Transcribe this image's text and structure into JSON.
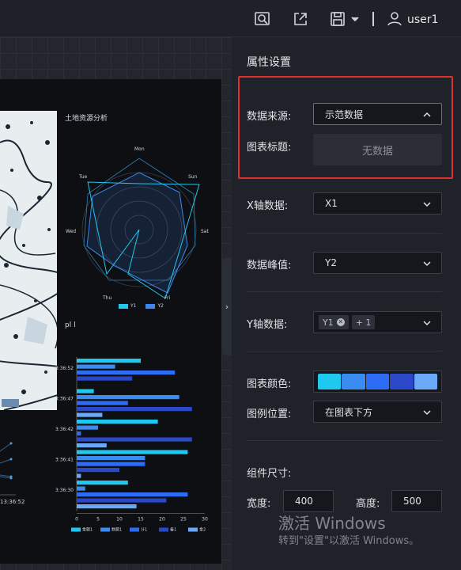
{
  "topbar": {
    "icons": [
      "search-doc-icon",
      "export-icon",
      "save-icon"
    ],
    "user_name": "user1"
  },
  "canvas": {
    "radar": {
      "title": "土地资源分析",
      "axes": [
        "Mon",
        "Sun",
        "Sat",
        "Fri",
        "Thu",
        "Wed",
        "Tue"
      ],
      "legend": [
        "Y1",
        "Y2"
      ]
    },
    "bar": {
      "title": "pl l",
      "categories": [
        "3:36:52",
        "3:36:47",
        "3:36:42",
        "3:36:41",
        "3:36:30"
      ],
      "x_ticks": [
        "0",
        "5",
        "10",
        "15",
        "20",
        "25",
        "30"
      ],
      "legend": [
        "金额1",
        "数额1",
        "计1",
        "备1",
        "金2"
      ]
    },
    "line_time_label": "13:36:52"
  },
  "chart_data": [
    {
      "type": "bar",
      "orientation": "horizontal",
      "title": "pl l",
      "categories": [
        "3:36:52",
        "3:36:47",
        "3:36:42",
        "3:36:41",
        "3:36:30"
      ],
      "xlim": [
        0,
        30
      ],
      "series": [
        {
          "name": "金额1",
          "values": [
            15,
            4,
            19,
            26,
            12
          ]
        },
        {
          "name": "数额1",
          "values": [
            9,
            24,
            5,
            16,
            2
          ]
        },
        {
          "name": "计1",
          "values": [
            23,
            12,
            1,
            16,
            26
          ]
        },
        {
          "name": "备1",
          "values": [
            13,
            27,
            27,
            10,
            21
          ]
        },
        {
          "name": "金2",
          "values": [
            0,
            6,
            7,
            1,
            14
          ]
        }
      ]
    }
  ],
  "panel": {
    "title": "属性设置",
    "data_source": {
      "label": "数据来源:",
      "value": "示范数据"
    },
    "chart_title": {
      "label": "图表标题:"
    },
    "dropdown_empty": "无数据",
    "x_axis": {
      "label": "X轴数据:",
      "value": "X1"
    },
    "peak": {
      "label": "数据峰值:",
      "value": "Y2"
    },
    "y_axis": {
      "label": "Y轴数据:",
      "tags": [
        "Y1",
        "+ 1"
      ]
    },
    "color": {
      "label": "图表颜色:",
      "swatches": [
        "#1ec8ef",
        "#3b8cf0",
        "#2d6cf5",
        "#2a48c8",
        "#6aa8f8"
      ]
    },
    "legend_pos": {
      "label": "图例位置:",
      "value": "在图表下方"
    },
    "size": {
      "label": "组件尺寸:",
      "width_label": "宽度:",
      "width_value": "400",
      "height_label": "高度:",
      "height_value": "500"
    }
  },
  "watermark": {
    "line1": "激活 Windows",
    "line2": "转到\"设置\"以激活 Windows。"
  }
}
